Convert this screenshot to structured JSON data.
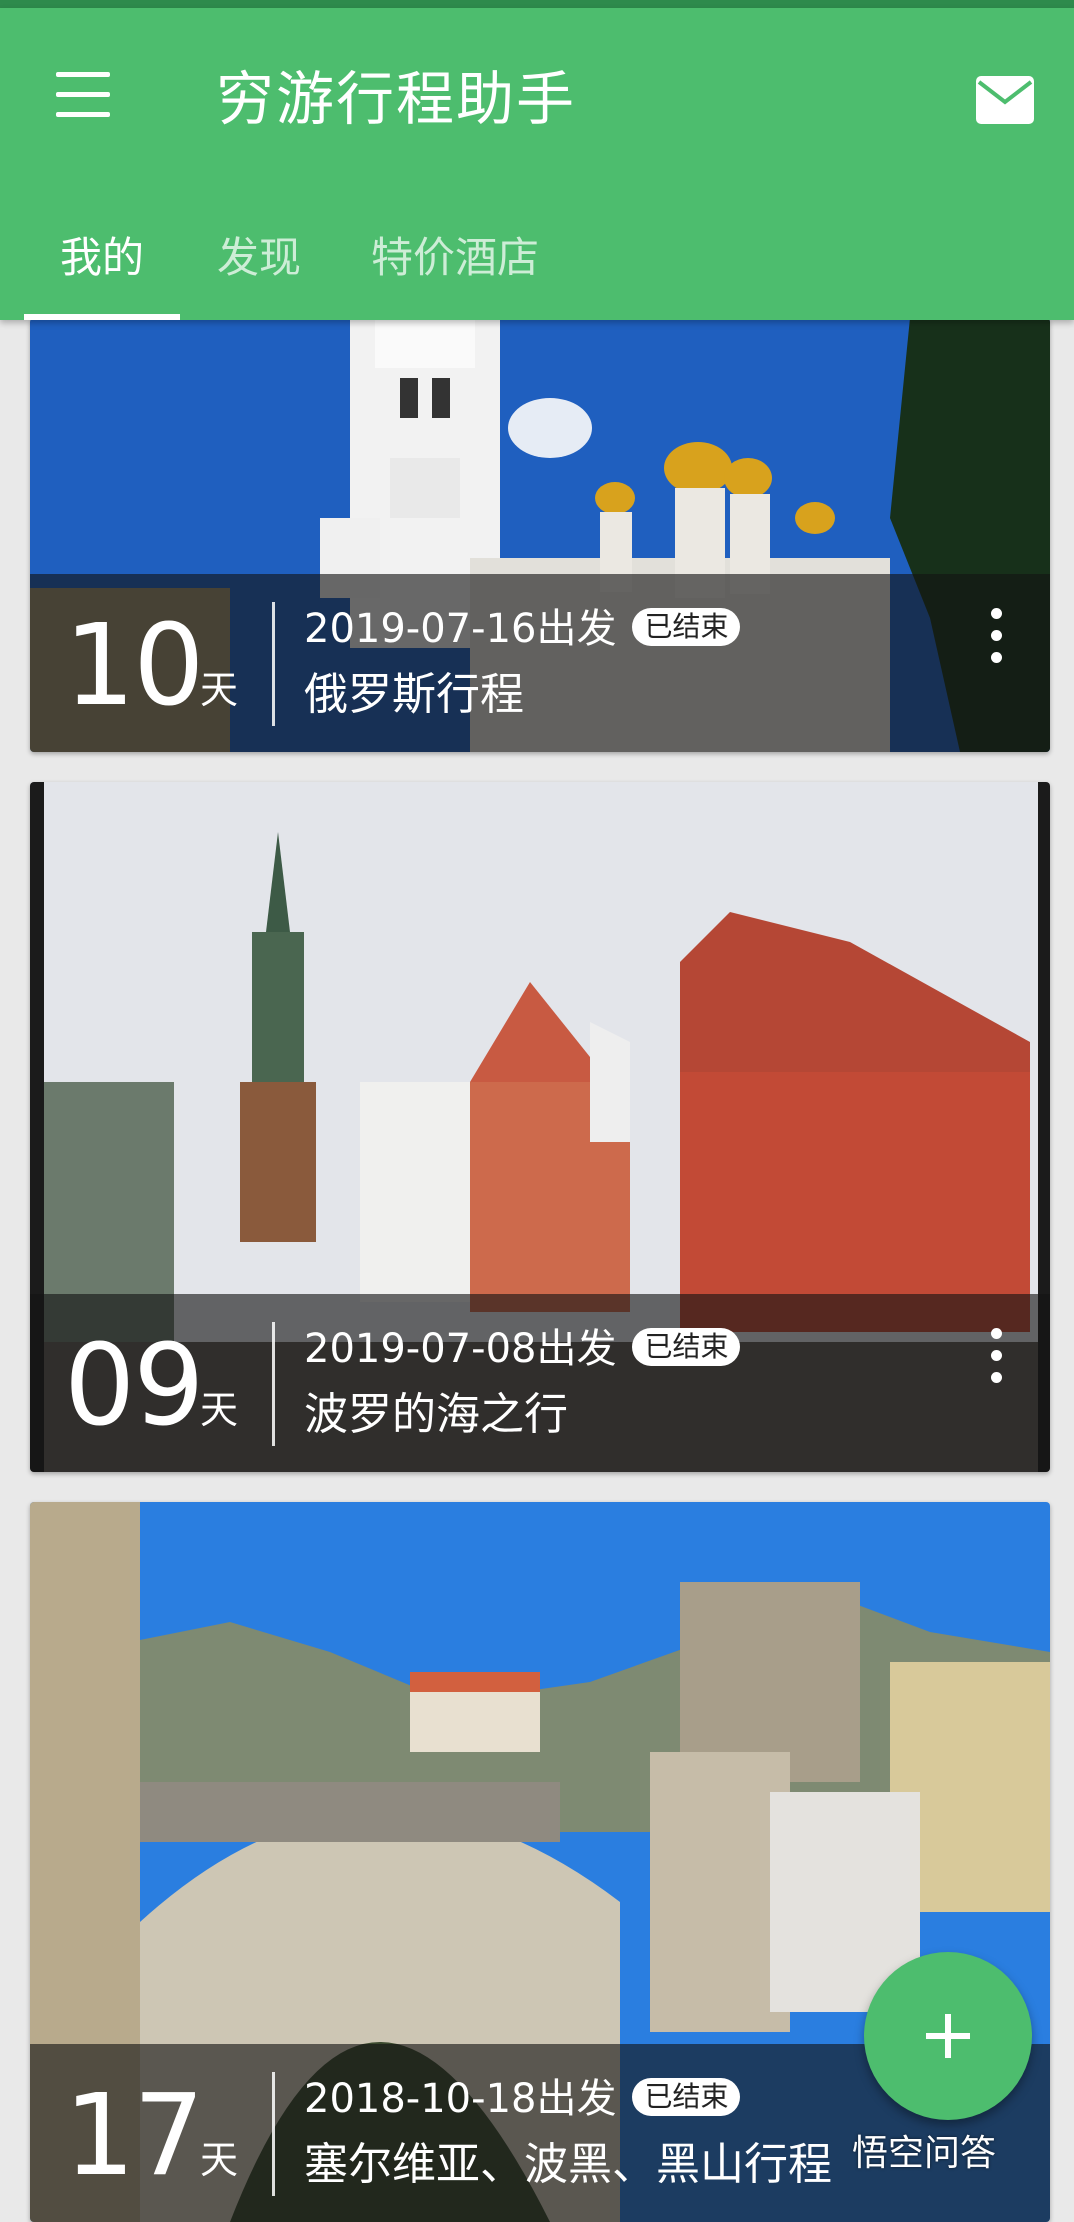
{
  "app": {
    "title": "穷游行程助手"
  },
  "header": {
    "menu_icon": "menu-icon",
    "mail_icon": "mail-icon",
    "tabs": [
      {
        "label": "我的",
        "active": true
      },
      {
        "label": "发现",
        "active": false
      },
      {
        "label": "特价酒店",
        "active": false
      }
    ]
  },
  "trips": [
    {
      "days": "10",
      "days_unit": "天",
      "date": "2019-07-16出发",
      "status": "已结束",
      "name": "俄罗斯行程"
    },
    {
      "days": "09",
      "days_unit": "天",
      "date": "2019-07-08出发",
      "status": "已结束",
      "name": "波罗的海之行"
    },
    {
      "days": "17",
      "days_unit": "天",
      "date": "2018-10-18出发",
      "status": "已结束",
      "name": "塞尔维亚、波黑、黑山行程"
    }
  ],
  "fab": {
    "icon": "plus-icon"
  },
  "watermark": "悟空问答",
  "colors": {
    "primary": "#4dbd6e",
    "status_bar": "#2e8a4c"
  }
}
